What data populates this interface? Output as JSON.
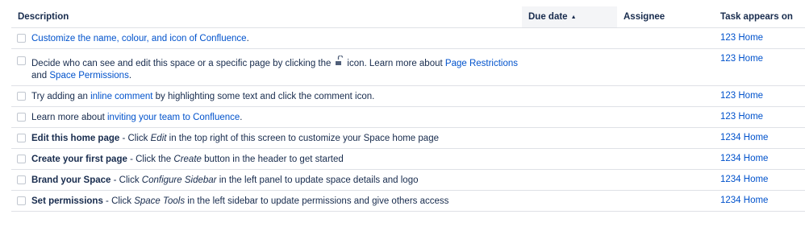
{
  "header": {
    "description": "Description",
    "due_date": "Due date",
    "assignee": "Assignee",
    "appears_on": "Task appears on"
  },
  "rows": [
    {
      "link": "Customize the name, colour, and icon of Confluence",
      "end": ".",
      "appears": "123 Home"
    },
    {
      "pre": "Decide who can see and edit this space or a specific page by clicking the",
      "mid": "icon. Learn more about",
      "link1": "Page Restrictions",
      "and": "and",
      "link2": "Space Permissions",
      "end": ".",
      "appears": "123 Home"
    },
    {
      "pre": "Try adding an",
      "link": "inline comment",
      "post": "by highlighting some text and click the comment icon.",
      "appears": "123 Home"
    },
    {
      "pre": "Learn more about",
      "link": "inviting your team to Confluence",
      "end": ".",
      "appears": "123 Home"
    },
    {
      "bold": "Edit this home page",
      "pre": "- Click",
      "italic": "Edit",
      "post": "in the top right of this screen to customize your Space home page",
      "appears": "1234 Home"
    },
    {
      "bold": "Create your first page",
      "pre": "- Click the",
      "italic": "Create",
      "post": "button in the header to get started",
      "appears": "1234 Home"
    },
    {
      "bold": "Brand your Space",
      "pre": "- Click",
      "italic": "Configure Sidebar",
      "post": "in the left panel to update space details and logo",
      "appears": "1234 Home"
    },
    {
      "bold": "Set permissions",
      "pre": "- Click",
      "italic": "Space Tools",
      "post": "in the left sidebar to update permissions and give others access",
      "appears": "1234 Home"
    }
  ],
  "icons": {
    "sort": "sort-ascending-icon",
    "lock": "unlock-icon",
    "checkbox": "checkbox-icon"
  },
  "colors": {
    "link": "#0052cc",
    "text": "#172b4d",
    "border": "#dfe1e6",
    "sorted_header_bg": "#f4f5f7"
  }
}
